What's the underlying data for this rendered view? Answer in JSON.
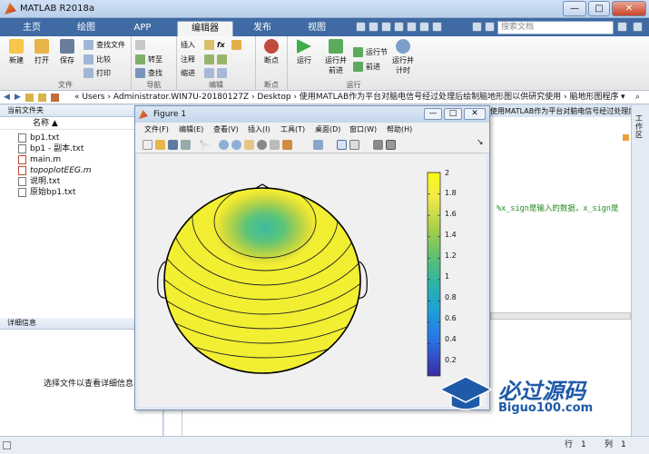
{
  "window": {
    "title": "MATLAB R2018a",
    "min": "—",
    "max": "□",
    "close": "✕"
  },
  "tabs": [
    "主页",
    "绘图",
    "APP",
    "编辑器",
    "发布",
    "视图"
  ],
  "active_tab": "编辑器",
  "search": {
    "placeholder": "搜索文档"
  },
  "ribbon": {
    "file_group": {
      "label": "文件",
      "new": "新建",
      "open": "打开",
      "save": "保存",
      "find_files": "查找文件",
      "compare": "比较",
      "print": "打印"
    },
    "nav_group": {
      "label": "导航",
      "goto": "转至",
      "find": "查找"
    },
    "edit_group": {
      "label": "编辑",
      "insert": "插入",
      "comment": "注释",
      "indent": "缩进",
      "fx": "fx"
    },
    "breakpoint_group": {
      "label": "断点",
      "breakpoint": "断点"
    },
    "run_group": {
      "label": "运行",
      "run": "运行",
      "run_advance": "运行并\n前进",
      "run_section": "运行节",
      "advance": "前进",
      "run_time": "运行并\n计时"
    }
  },
  "address": {
    "path": "« Users › Administrator.WIN7U-20180127Z › Desktop › 使用MATLAB作为平台对脑电信号经过处理后绘制脑地形图以供研究使用 › 脑地形图程序"
  },
  "current_folder": {
    "header": "当前文件夹",
    "col_name": "名称 ▲",
    "files": [
      "bp1.txt",
      "bp1 - 副本.txt",
      "main.m",
      "topoplotEEG.m",
      "说明.txt",
      "原始bp1.txt"
    ]
  },
  "details": {
    "header": "详细信息",
    "hint": "选择文件以查看详细信息"
  },
  "editor": {
    "tab_title": "使用MATLAB作为平台对脑电信号经过处理后绘制脑地形图...",
    "code_comment": "%x_sign是输入的数据，x_sign是"
  },
  "right_strip": {
    "label": "工作区"
  },
  "status": {
    "row_label": "行",
    "row": "1",
    "col_label": "列",
    "col": "1"
  },
  "figure": {
    "title": "Figure 1",
    "menu": [
      "文件(F)",
      "编辑(E)",
      "查看(V)",
      "插入(I)",
      "工具(T)",
      "桌面(D)",
      "窗口(W)",
      "帮助(H)"
    ],
    "colorbar_ticks": [
      "2",
      "1.8",
      "1.6",
      "1.4",
      "1.2",
      "1",
      "0.8",
      "0.6",
      "0.4",
      "0.2"
    ],
    "colorbar_range": [
      0.1,
      2.0
    ]
  },
  "watermark": {
    "brand": "必过源码",
    "url": "Biguo100.com"
  },
  "colors": {
    "ribbon_tab_bg": "#3f6aa3",
    "head_fill": "#f2ef32",
    "hot_spot": "#3dbf9a",
    "comment_green": "#228b22"
  }
}
